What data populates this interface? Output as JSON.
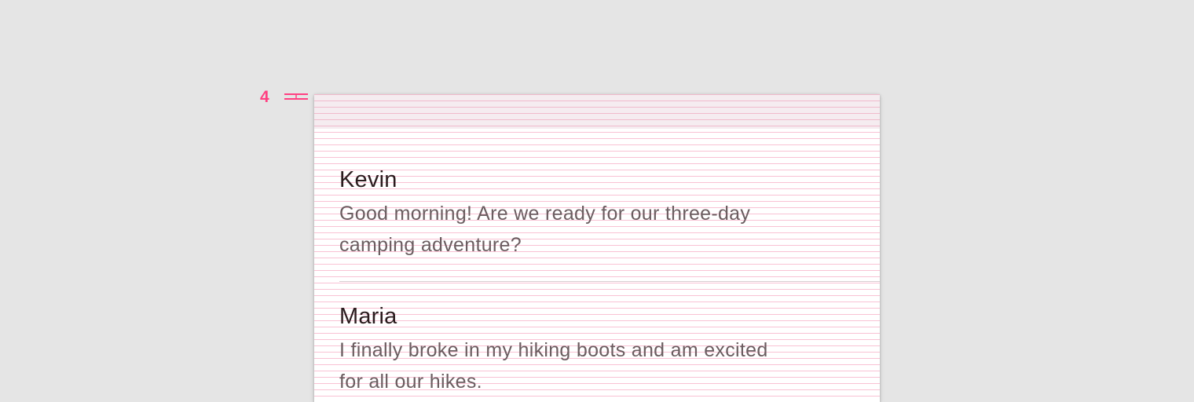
{
  "spec": {
    "spacing_label": "4"
  },
  "colors": {
    "accent": "#ff4081",
    "grid_line": "#f48fb1",
    "name_text": "#2b1c1e",
    "message_text": "#6b5d60",
    "background": "#e5e5e5"
  },
  "list": {
    "items": [
      {
        "name": "Kevin",
        "message": "Good morning! Are we ready for our three-day camping adventure?"
      },
      {
        "name": "Maria",
        "message": "I finally broke in my hiking boots and am excited for all our hikes."
      }
    ]
  }
}
